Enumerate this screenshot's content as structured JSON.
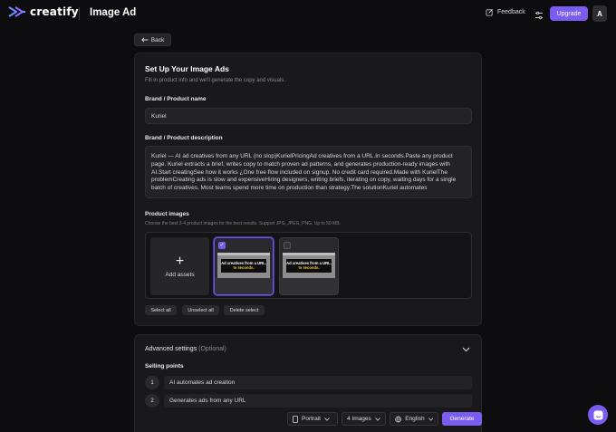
{
  "header": {
    "logo_text": "creatify",
    "page_title": "Image Ad",
    "feedback_label": "Feedback",
    "upgrade_label": "Upgrade",
    "avatar_initial": "A",
    "back_label": "Back"
  },
  "form": {
    "title": "Set Up Your Image Ads",
    "subtitle": "Fill in product info and we'll generate the copy and visuals.",
    "brand_label": "Brand / Product name",
    "brand_value": "Kuriel",
    "description_label": "Brand / Product description",
    "description_value": "Kuriel — AI ad creatives from any URL (no slop)KurielPricingAd creatives from a URL.In seconds.Paste any product page. Kuriel extracts a brief, writes copy to match proven ad patterns, and generates production-ready images with AI.Start creatingSee how it works ¿One free flow included on signup. No credit card required.Made with KurielThe problemCreating ads is slow and expensiveHiring designers, writing briefs, iterating on copy, waiting days for a single batch of creatives. Most teams spend more time on production than strategy.The solutionKuriel automates",
    "images_label": "Product images",
    "images_hint": "Choose the best 3-4 product images for the best results. Support JPG, JPEG, PNG. Up to 50 MB.",
    "add_assets_label": "Add assets",
    "thumb_line1": "Ad creatives from a URL.",
    "thumb_line2": "In seconds.",
    "select_all": "Select all",
    "unselect_all": "Unselect all",
    "delete_select": "Delete select"
  },
  "advanced": {
    "title": "Advanced settings",
    "optional": "(Optional)",
    "selling_points_label": "Selling points",
    "selling_points": [
      {
        "num": "1",
        "text": "AI automates ad creation"
      },
      {
        "num": "2",
        "text": "Generates ads from any URL"
      }
    ]
  },
  "toolbar": {
    "orientation": "Portrait",
    "count": "4 Images",
    "language": "English",
    "generate": "Generate"
  },
  "colors": {
    "accent": "#7b5cf0",
    "background": "#0d0d0f",
    "card": "#19191c"
  }
}
